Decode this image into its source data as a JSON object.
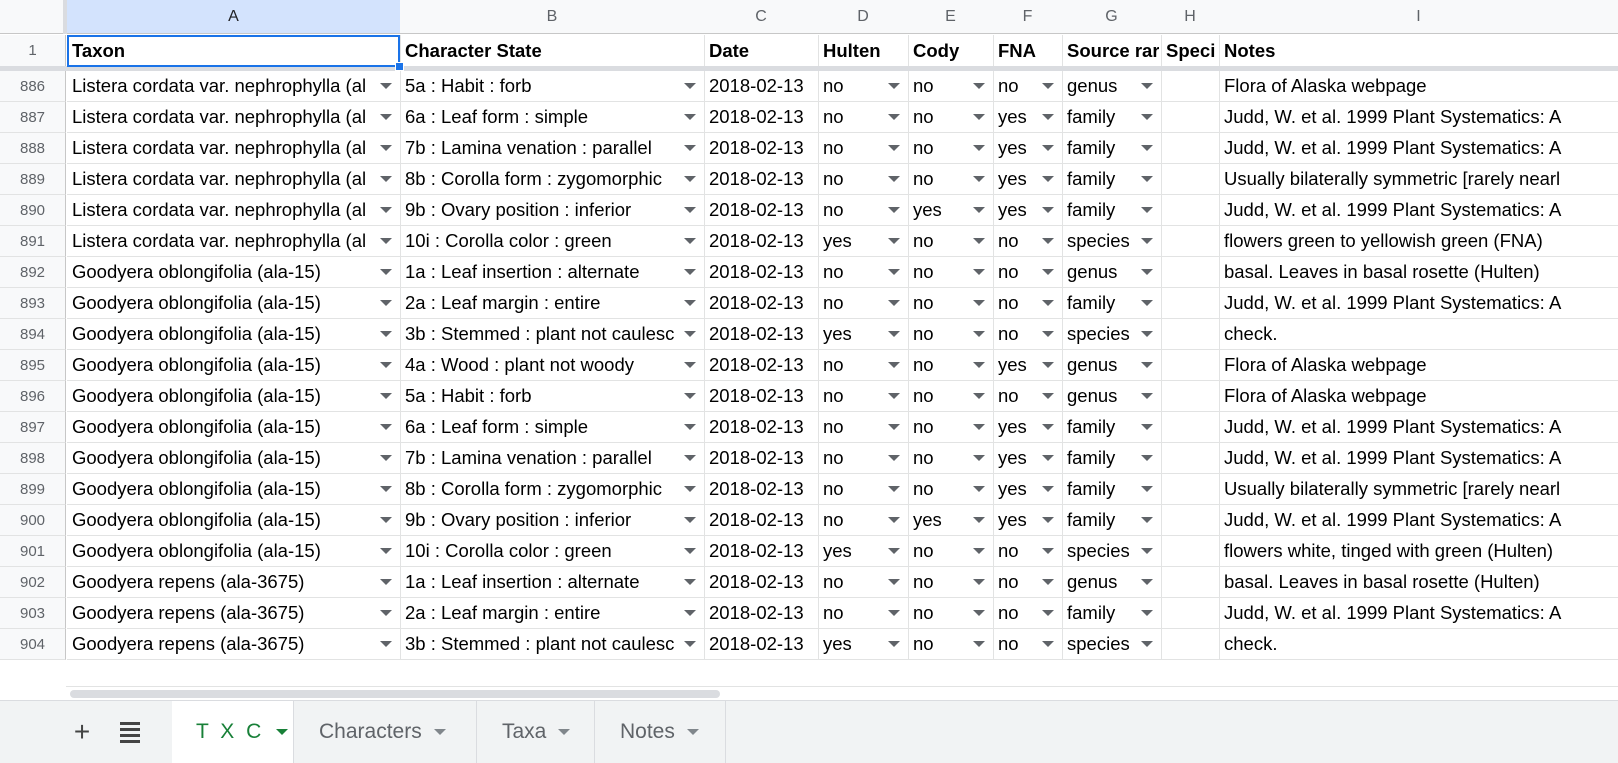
{
  "columns": [
    "A",
    "B",
    "C",
    "D",
    "E",
    "F",
    "G",
    "H",
    "I"
  ],
  "header_row": {
    "number": "1",
    "cells": [
      "Taxon",
      "Character State",
      "Date",
      "Hulten",
      "Cody",
      "FNA",
      "Source rar",
      "Speci",
      "Notes"
    ]
  },
  "rows": [
    {
      "n": "886",
      "a": "Listera cordata var. nephrophylla (al",
      "b": "5a : Habit : forb",
      "c": "2018-02-13",
      "d": "no",
      "e": "no",
      "f": "no",
      "g": "genus",
      "h": "",
      "i": "Flora of Alaska webpage"
    },
    {
      "n": "887",
      "a": "Listera cordata var. nephrophylla (al",
      "b": "6a : Leaf form : simple",
      "c": "2018-02-13",
      "d": "no",
      "e": "no",
      "f": "yes",
      "g": "family",
      "h": "",
      "i": "Judd, W. et al. 1999 Plant Systematics: A"
    },
    {
      "n": "888",
      "a": "Listera cordata var. nephrophylla (al",
      "b": "7b : Lamina venation : parallel",
      "c": "2018-02-13",
      "d": "no",
      "e": "no",
      "f": "yes",
      "g": "family",
      "h": "",
      "i": "Judd, W. et al. 1999 Plant Systematics: A"
    },
    {
      "n": "889",
      "a": "Listera cordata var. nephrophylla (al",
      "b": "8b : Corolla form : zygomorphic",
      "c": "2018-02-13",
      "d": "no",
      "e": "no",
      "f": "yes",
      "g": "family",
      "h": "",
      "i": "Usually bilaterally symmetric [rarely nearl"
    },
    {
      "n": "890",
      "a": "Listera cordata var. nephrophylla (al",
      "b": "9b : Ovary position : inferior",
      "c": "2018-02-13",
      "d": "no",
      "e": "yes",
      "f": "yes",
      "g": "family",
      "h": "",
      "i": "Judd, W. et al. 1999 Plant Systematics: A"
    },
    {
      "n": "891",
      "a": "Listera cordata var. nephrophylla (al",
      "b": "10i : Corolla color : green",
      "c": "2018-02-13",
      "d": "yes",
      "e": "no",
      "f": "no",
      "g": "species",
      "h": "",
      "i": "flowers green to yellowish green (FNA)"
    },
    {
      "n": "892",
      "a": "Goodyera oblongifolia (ala-15)",
      "b": "1a : Leaf insertion : alternate",
      "c": "2018-02-13",
      "d": "no",
      "e": "no",
      "f": "no",
      "g": "genus",
      "h": "",
      "i": "basal. Leaves in basal rosette (Hulten)"
    },
    {
      "n": "893",
      "a": "Goodyera oblongifolia (ala-15)",
      "b": "2a : Leaf margin : entire",
      "c": "2018-02-13",
      "d": "no",
      "e": "no",
      "f": "no",
      "g": "family",
      "h": "",
      "i": "Judd, W. et al. 1999 Plant Systematics: A"
    },
    {
      "n": "894",
      "a": "Goodyera oblongifolia (ala-15)",
      "b": "3b : Stemmed : plant not caulesc",
      "c": "2018-02-13",
      "d": "yes",
      "e": "no",
      "f": "no",
      "g": "species",
      "h": "",
      "i": "check."
    },
    {
      "n": "895",
      "a": "Goodyera oblongifolia (ala-15)",
      "b": "4a : Wood : plant not woody",
      "c": "2018-02-13",
      "d": "no",
      "e": "no",
      "f": "yes",
      "g": "genus",
      "h": "",
      "i": "Flora of Alaska webpage"
    },
    {
      "n": "896",
      "a": "Goodyera oblongifolia (ala-15)",
      "b": "5a : Habit : forb",
      "c": "2018-02-13",
      "d": "no",
      "e": "no",
      "f": "no",
      "g": "genus",
      "h": "",
      "i": "Flora of Alaska webpage"
    },
    {
      "n": "897",
      "a": "Goodyera oblongifolia (ala-15)",
      "b": "6a : Leaf form : simple",
      "c": "2018-02-13",
      "d": "no",
      "e": "no",
      "f": "yes",
      "g": "family",
      "h": "",
      "i": "Judd, W. et al. 1999 Plant Systematics: A"
    },
    {
      "n": "898",
      "a": "Goodyera oblongifolia (ala-15)",
      "b": "7b : Lamina venation : parallel",
      "c": "2018-02-13",
      "d": "no",
      "e": "no",
      "f": "yes",
      "g": "family",
      "h": "",
      "i": "Judd, W. et al. 1999 Plant Systematics: A"
    },
    {
      "n": "899",
      "a": "Goodyera oblongifolia (ala-15)",
      "b": "8b : Corolla form : zygomorphic",
      "c": "2018-02-13",
      "d": "no",
      "e": "no",
      "f": "yes",
      "g": "family",
      "h": "",
      "i": "Usually bilaterally symmetric [rarely nearl"
    },
    {
      "n": "900",
      "a": "Goodyera oblongifolia (ala-15)",
      "b": "9b : Ovary position : inferior",
      "c": "2018-02-13",
      "d": "no",
      "e": "yes",
      "f": "yes",
      "g": "family",
      "h": "",
      "i": "Judd, W. et al. 1999 Plant Systematics: A"
    },
    {
      "n": "901",
      "a": "Goodyera oblongifolia (ala-15)",
      "b": "10i : Corolla color : green",
      "c": "2018-02-13",
      "d": "yes",
      "e": "no",
      "f": "no",
      "g": "species",
      "h": "",
      "i": "flowers white, tinged with green (Hulten)"
    },
    {
      "n": "902",
      "a": "Goodyera repens (ala-3675)",
      "b": "1a : Leaf insertion : alternate",
      "c": "2018-02-13",
      "d": "no",
      "e": "no",
      "f": "no",
      "g": "genus",
      "h": "",
      "i": "basal. Leaves in basal rosette (Hulten)"
    },
    {
      "n": "903",
      "a": "Goodyera repens (ala-3675)",
      "b": "2a : Leaf margin : entire",
      "c": "2018-02-13",
      "d": "no",
      "e": "no",
      "f": "no",
      "g": "family",
      "h": "",
      "i": "Judd, W. et al. 1999 Plant Systematics: A"
    },
    {
      "n": "904",
      "a": "Goodyera repens (ala-3675)",
      "b": "3b : Stemmed : plant not caulesc",
      "c": "2018-02-13",
      "d": "yes",
      "e": "no",
      "f": "no",
      "g": "species",
      "h": "",
      "i": "check."
    }
  ],
  "sheet_tabs": [
    {
      "label": "T X C",
      "active": true
    },
    {
      "label": "Characters",
      "active": false
    },
    {
      "label": "Taxa",
      "active": false
    },
    {
      "label": "Notes",
      "active": false
    }
  ],
  "icons": {
    "add_sheet": "plus-icon",
    "all_sheets": "menu-icon"
  },
  "colors": {
    "selection": "#1a73e8",
    "active_tab": "#188038",
    "header_bg": "#f8f9fa",
    "selected_col_bg": "#d3e3fd"
  }
}
